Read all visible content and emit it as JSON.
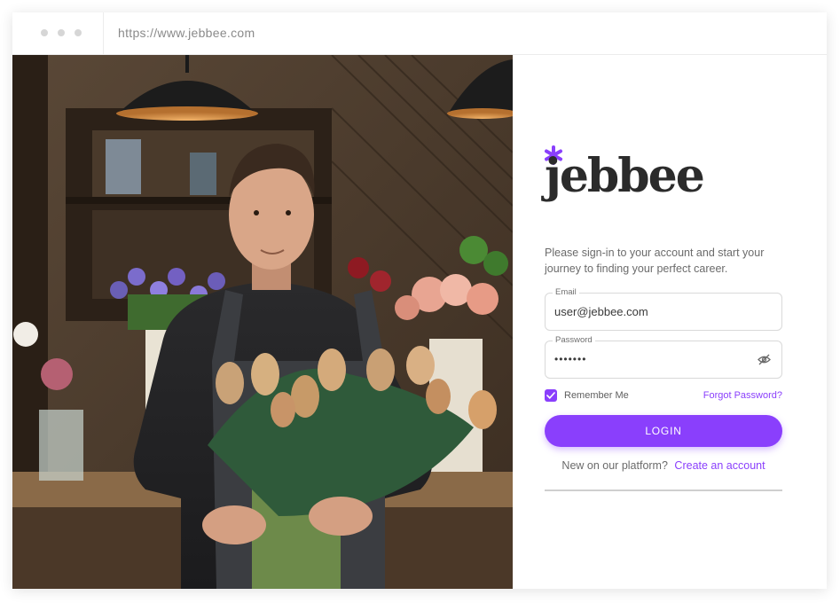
{
  "browser": {
    "url": "https://www.jebbee.com"
  },
  "brand": {
    "name": "jebbee",
    "accent_color": "#8a3ffc"
  },
  "login": {
    "welcome_text": "Please sign-in to your account and start your journey to finding your perfect career.",
    "email_label": "Email",
    "email_value": "user@jebbee.com",
    "password_label": "Password",
    "password_value": "•••••••",
    "remember_label": "Remember Me",
    "remember_checked": true,
    "forgot_label": "Forgot Password?",
    "login_label": "LOGIN",
    "signup_prompt": "New on our platform?",
    "signup_link": "Create an account"
  },
  "icons": {
    "password_toggle": "eye-slash-icon",
    "checkbox": "checkmark-icon",
    "logo_mark": "asterisk-icon"
  }
}
